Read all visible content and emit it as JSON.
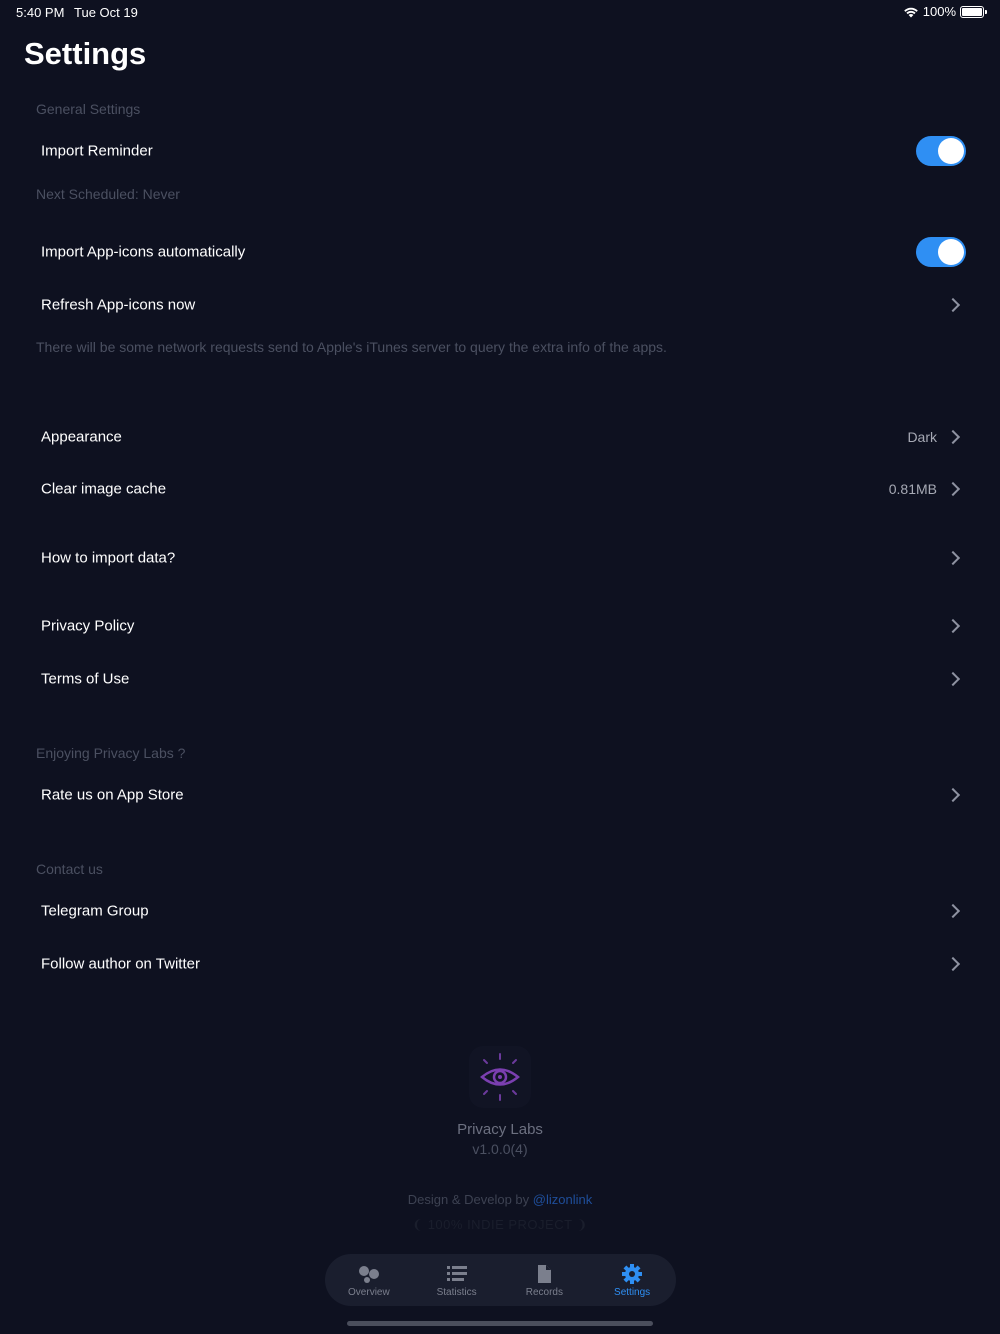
{
  "status": {
    "time": "5:40 PM",
    "date": "Tue Oct 19",
    "battery": "100%",
    "wifi_icon": "wifi-icon",
    "battery_icon": "battery-icon"
  },
  "page": {
    "title": "Settings"
  },
  "general": {
    "header": "General Settings",
    "import_reminder": {
      "label": "Import Reminder",
      "on": true
    },
    "next_scheduled": "Next Scheduled: Never",
    "import_icons_auto": {
      "label": "Import App-icons automatically",
      "on": true
    },
    "refresh_icons": {
      "label": "Refresh App-icons now"
    },
    "network_note": "There will be some network requests send to Apple's iTunes server to query the extra info of the apps."
  },
  "display": {
    "appearance": {
      "label": "Appearance",
      "value": "Dark"
    },
    "clear_cache": {
      "label": "Clear image cache",
      "value": "0.81MB"
    }
  },
  "help": {
    "how_to_import": {
      "label": "How to import data?"
    }
  },
  "legal": {
    "privacy_policy": {
      "label": "Privacy Policy"
    },
    "terms": {
      "label": "Terms of Use"
    }
  },
  "enjoying": {
    "header": "Enjoying Privacy Labs ?",
    "rate": {
      "label": "Rate us on App Store"
    }
  },
  "contact": {
    "header": "Contact us",
    "telegram": {
      "label": "Telegram Group"
    },
    "twitter": {
      "label": "Follow author on Twitter"
    }
  },
  "about": {
    "app_name": "Privacy Labs",
    "version": "v1.0.0(4)",
    "credits_prefix": "Design & Develop by",
    "credits_handle": "@lizonlink",
    "indie": "100% INDIE PROJECT"
  },
  "tabs": [
    {
      "label": "Overview",
      "icon": "overview-icon",
      "active": false
    },
    {
      "label": "Statistics",
      "icon": "statistics-icon",
      "active": false
    },
    {
      "label": "Records",
      "icon": "records-icon",
      "active": false
    },
    {
      "label": "Settings",
      "icon": "gear-icon",
      "active": true
    }
  ],
  "colors": {
    "background": "#0e1120",
    "accent": "#2f8ff3",
    "section_text": "#4b5061",
    "eye_purple": "#7b3fb0"
  }
}
